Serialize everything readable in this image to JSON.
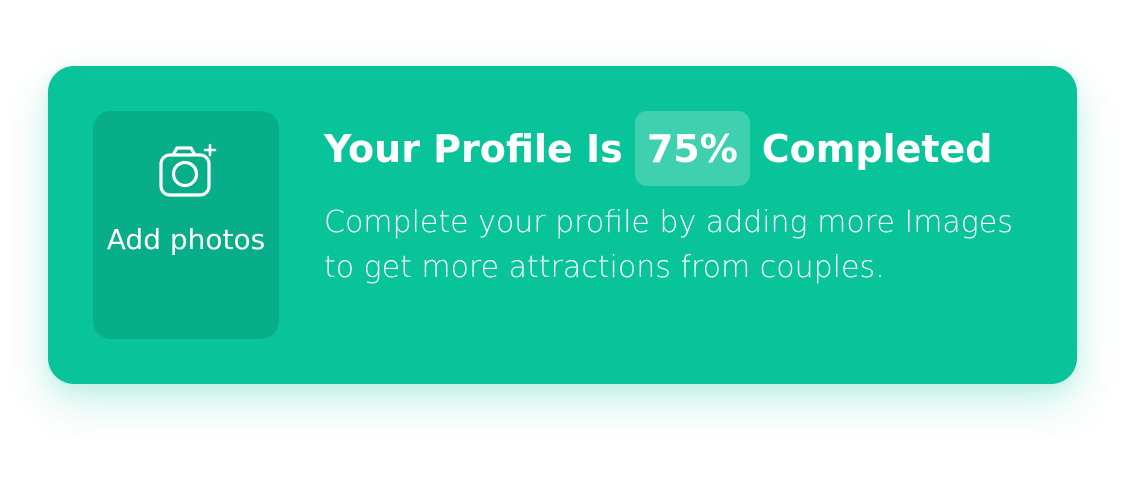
{
  "card": {
    "background_color": "#09C39A",
    "add_photos": {
      "icon": "camera-plus-icon",
      "label": "Add photos"
    },
    "title": {
      "prefix": "Your Profile Is",
      "percent_text": "75%",
      "suffix": "Completed",
      "completion_percent": 75
    },
    "description": "Complete your profile by adding more Images to get more attractions from couples."
  }
}
